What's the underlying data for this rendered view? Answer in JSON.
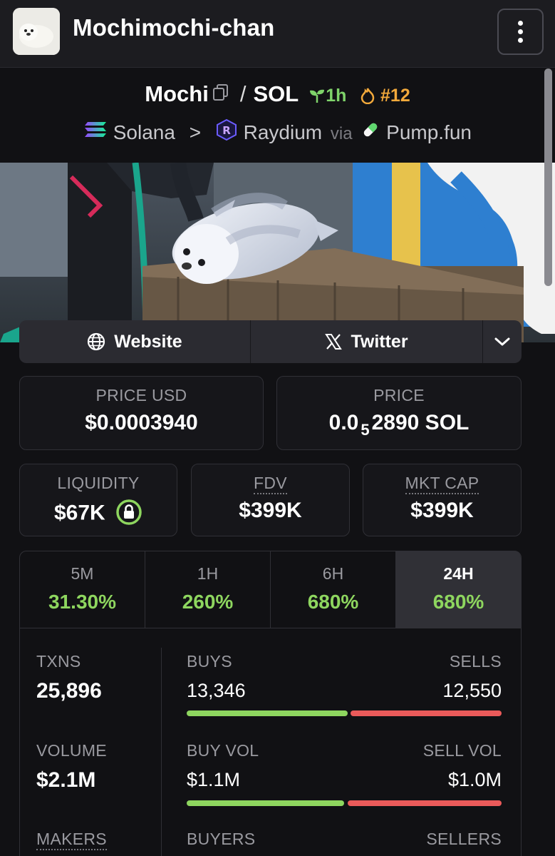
{
  "header": {
    "title": "Mochimochi-chan",
    "avatar_icon": "seal-plush-image",
    "menu_icon": "kebab-menu-icon"
  },
  "pair": {
    "base": "Mochi",
    "sep": "/",
    "quote": "SOL",
    "age": "1h",
    "rank": "#12",
    "chain": "Solana",
    "dex": "Raydium",
    "via": "via",
    "launchpad": "Pump.fun"
  },
  "links": {
    "website": "Website",
    "twitter": "Twitter"
  },
  "price": {
    "usd_label": "PRICE USD",
    "usd_value": "$0.0003940",
    "sol_label": "PRICE",
    "sol_prefix": "0.0",
    "sol_sub": "5",
    "sol_rest": "2890 SOL"
  },
  "metrics": {
    "liq_label": "LIQUIDITY",
    "liq_value": "$67K",
    "fdv_label": "FDV",
    "fdv_value": "$399K",
    "mcap_label": "MKT CAP",
    "mcap_value": "$399K"
  },
  "timeframes": [
    {
      "label": "5M",
      "value": "31.30%"
    },
    {
      "label": "1H",
      "value": "260%"
    },
    {
      "label": "6H",
      "value": "680%"
    },
    {
      "label": "24H",
      "value": "680%"
    }
  ],
  "stats": {
    "txns_label": "TXNS",
    "txns_value": "25,896",
    "buys_label": "BUYS",
    "buys_value": "13,346",
    "sells_label": "SELLS",
    "sells_value": "12,550",
    "volume_label": "VOLUME",
    "volume_value": "$2.1M",
    "buyvol_label": "BUY VOL",
    "buyvol_value": "$1.1M",
    "sellvol_label": "SELL VOL",
    "sellvol_value": "$1.0M",
    "makers_label": "MAKERS",
    "buyers_label": "BUYERS",
    "sellers_label": "SELLERS"
  },
  "colors": {
    "accent_green": "#8ed65f",
    "sell_red": "#ea5a5a",
    "rank_orange": "#f2a93b"
  }
}
